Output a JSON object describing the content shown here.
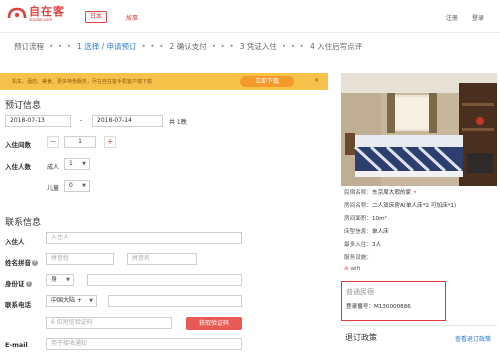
{
  "header": {
    "logo_name": "自在客",
    "logo_url": "zizaike.com",
    "region": "日本",
    "link": "故事",
    "register": "注册",
    "login": "登录"
  },
  "steps": [
    {
      "label": "预订流程",
      "active": false
    },
    {
      "label": "1 选择 / 申请预订",
      "active": true
    },
    {
      "label": "2 确认支付",
      "active": false
    },
    {
      "label": "3 凭证入住",
      "active": false
    },
    {
      "label": "4 入住后写点评",
      "active": false
    }
  ],
  "step_separator": "• • •",
  "banner": {
    "text": "机车、酒店、美食、更多特色服务，尽在自在客手机客户端下载",
    "button": "立即下载",
    "close": "✕"
  },
  "booking": {
    "title": "预订信息",
    "checkin": "2018-07-13",
    "dash": "-",
    "checkout": "2018-07-14",
    "nights": "共 1晚",
    "rooms_label": "入住间数",
    "rooms_value": "1",
    "minus": "−",
    "plus": "+",
    "guests_label": "入住人数",
    "adults_label": "成人",
    "adults_value": "1",
    "children_label": "儿童",
    "children_value": "0"
  },
  "contact": {
    "title": "联系信息",
    "name_label": "入住人",
    "name_placeholder": "入住人",
    "pinyin_label": "姓名拼音",
    "surname_placeholder": "拼音姓",
    "given_placeholder": "拼音名",
    "id_label": "身份证",
    "id_type": "身",
    "phone_label": "联系电话",
    "country": "中国大陆 +",
    "sms_placeholder": "6 位短信验证码",
    "code_button": "获取验证码",
    "email_label": "E-mail",
    "email_placeholder": "用于接收通知"
  },
  "property": {
    "rows": [
      {
        "k": "民宿名称：",
        "v": "东京周大瑕的家"
      },
      {
        "k": "房间名称：",
        "v": "二人双床房A(单人床*2 可加床*1)"
      },
      {
        "k": "房间面积：",
        "v": "10m²"
      },
      {
        "k": "床型信息：",
        "v": "单人床"
      },
      {
        "k": "最多入住：",
        "v": "3人"
      },
      {
        "k": "服务设施：",
        "v": ""
      }
    ],
    "wifi": "wifi",
    "notice_title": "普通民宿",
    "registration": "登录番号：M130000886",
    "policy_title": "退订政策",
    "policy_link": "查看退订政策"
  },
  "colors": {
    "brand": "#e2413f",
    "link": "#2a7bd6",
    "banner": "#f6c24a",
    "banner_button": "#f39a2a"
  }
}
